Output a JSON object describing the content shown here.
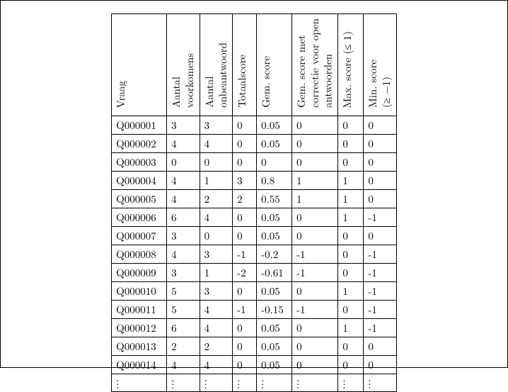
{
  "headers": [
    "Vraag",
    "Aantal\nvoorkomens",
    "Aantal\nonbeantwoord",
    "Totaalscore",
    "Gem. score",
    "Gem. score met\ncorrectie voor open\nantwoorden",
    "Max. score (≤ 1)",
    "Min. score\n(≥ −1)"
  ],
  "rows": [
    [
      "Q000001",
      "3",
      "3",
      "0",
      "0.05",
      "0",
      "0",
      "0"
    ],
    [
      "Q000002",
      "4",
      "4",
      "0",
      "0.05",
      "0",
      "0",
      "0"
    ],
    [
      "Q000003",
      "0",
      "0",
      "0",
      "0",
      "0",
      "0",
      "0"
    ],
    [
      "Q000004",
      "4",
      "1",
      "3",
      "0.8",
      "1",
      "1",
      "0"
    ],
    [
      "Q000005",
      "4",
      "2",
      "2",
      "0.55",
      "1",
      "1",
      "0"
    ],
    [
      "Q000006",
      "6",
      "4",
      "0",
      "0.05",
      "0",
      "1",
      "-1"
    ],
    [
      "Q000007",
      "3",
      "0",
      "0",
      "0.05",
      "0",
      "0",
      "0"
    ],
    [
      "Q000008",
      "4",
      "3",
      "-1",
      "-0.2",
      "-1",
      "0",
      "-1"
    ],
    [
      "Q000009",
      "3",
      "1",
      "-2",
      "-0.61",
      "-1",
      "0",
      "-1"
    ],
    [
      "Q000010",
      "5",
      "3",
      "0",
      "0.05",
      "0",
      "1",
      "-1"
    ],
    [
      "Q000011",
      "5",
      "4",
      "-1",
      "-0.15",
      "-1",
      "0",
      "-1"
    ],
    [
      "Q000012",
      "6",
      "4",
      "0",
      "0.05",
      "0",
      "1",
      "-1"
    ],
    [
      "Q000013",
      "2",
      "2",
      "0",
      "0.05",
      "0",
      "0",
      "0"
    ],
    [
      "Q000014",
      "4",
      "4",
      "0",
      "0.05",
      "0",
      "0",
      "0"
    ]
  ],
  "chart_data": {
    "type": "table",
    "title": "",
    "columns": [
      "Vraag",
      "Aantal voorkomens",
      "Aantal onbeantwoord",
      "Totaalscore",
      "Gem. score",
      "Gem. score met correctie voor open antwoorden",
      "Max. score (≤ 1)",
      "Min. score (≥ −1)"
    ],
    "rows": [
      [
        "Q000001",
        3,
        3,
        0,
        0.05,
        0,
        0,
        0
      ],
      [
        "Q000002",
        4,
        4,
        0,
        0.05,
        0,
        0,
        0
      ],
      [
        "Q000003",
        0,
        0,
        0,
        0,
        0,
        0,
        0
      ],
      [
        "Q000004",
        4,
        1,
        3,
        0.8,
        1,
        1,
        0
      ],
      [
        "Q000005",
        4,
        2,
        2,
        0.55,
        1,
        1,
        0
      ],
      [
        "Q000006",
        6,
        4,
        0,
        0.05,
        0,
        1,
        -1
      ],
      [
        "Q000007",
        3,
        0,
        0,
        0.05,
        0,
        0,
        0
      ],
      [
        "Q000008",
        4,
        3,
        -1,
        -0.2,
        -1,
        0,
        -1
      ],
      [
        "Q000009",
        3,
        1,
        -2,
        -0.61,
        -1,
        0,
        -1
      ],
      [
        "Q000010",
        5,
        3,
        0,
        0.05,
        0,
        1,
        -1
      ],
      [
        "Q000011",
        5,
        4,
        -1,
        -0.15,
        -1,
        0,
        -1
      ],
      [
        "Q000012",
        6,
        4,
        0,
        0.05,
        0,
        1,
        -1
      ],
      [
        "Q000013",
        2,
        2,
        0,
        0.05,
        0,
        0,
        0
      ],
      [
        "Q000014",
        4,
        4,
        0,
        0.05,
        0,
        0,
        0
      ]
    ],
    "truncated": true
  }
}
